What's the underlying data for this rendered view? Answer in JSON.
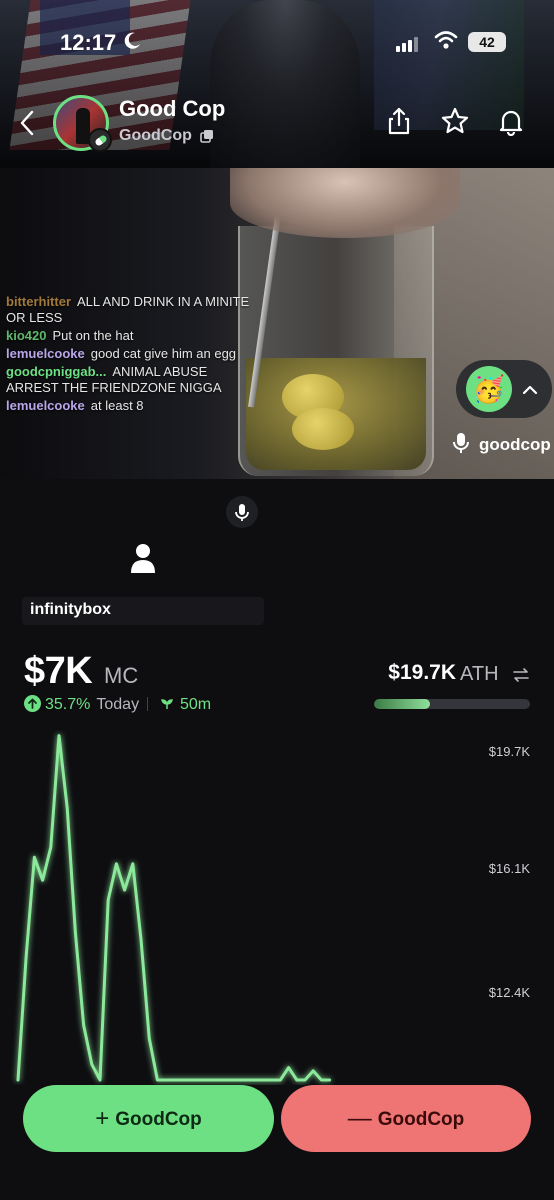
{
  "status_bar": {
    "time": "12:17",
    "battery": "42"
  },
  "header": {
    "name": "Good Cop",
    "ticker": "GoodCop"
  },
  "chat": [
    {
      "user": "bitterhitter",
      "color": "#a2793b",
      "text": "ALL AND DRINK IN A MINITE OR LESS"
    },
    {
      "user": "kio420",
      "color": "#5fb86b",
      "text": "Put on the hat"
    },
    {
      "user": "lemuelcooke",
      "color": "#b9a6e8",
      "text": "good cat give him an egg"
    },
    {
      "user": "goodcpniggab...",
      "color": "#6ee084",
      "text": "ANIMAL ABUSE ARREST THE FRIENDZONE NIGGA"
    },
    {
      "user": "lemuelcooke",
      "color": "#b9a6e8",
      "text": "at least 8"
    }
  ],
  "stream": {
    "host": "goodcop",
    "reaction_emoji": "🥳"
  },
  "label_box": "infinitybox",
  "market": {
    "mc_value": "$7K",
    "mc_label": "MC",
    "change_pct": "35.7%",
    "change_period": "Today",
    "time_ago": "50m",
    "ath_value": "$19.7K",
    "ath_label": "ATH",
    "ath_progress": 0.36
  },
  "chart_data": {
    "type": "line",
    "y_tick_labels": [
      "$19.7K",
      "$16.1K",
      "$12.4K"
    ],
    "y_ticks": [
      19.7,
      16.1,
      12.4
    ],
    "series": [
      {
        "values": [
          9.0,
          13.5,
          16.5,
          15.8,
          16.8,
          20.2,
          18.0,
          14.2,
          11.4,
          10.2,
          9.0,
          15.2,
          16.3,
          15.5,
          16.3,
          14.0,
          11.0,
          9.0,
          9.0,
          9.3,
          9.0,
          9.0,
          9.0,
          9.2,
          9.0,
          9.4,
          9.0,
          9.0,
          9.2,
          9.0,
          9.0,
          9.0,
          9.5,
          10.1,
          9.6,
          9.5,
          10.0,
          9.5,
          9.2
        ]
      }
    ]
  },
  "actions": {
    "buy_label": "GoodCop",
    "sell_label": "GoodCop"
  },
  "colors": {
    "accent": "#6ee084",
    "sell": "#ef7474",
    "background": "#0e0e11"
  }
}
